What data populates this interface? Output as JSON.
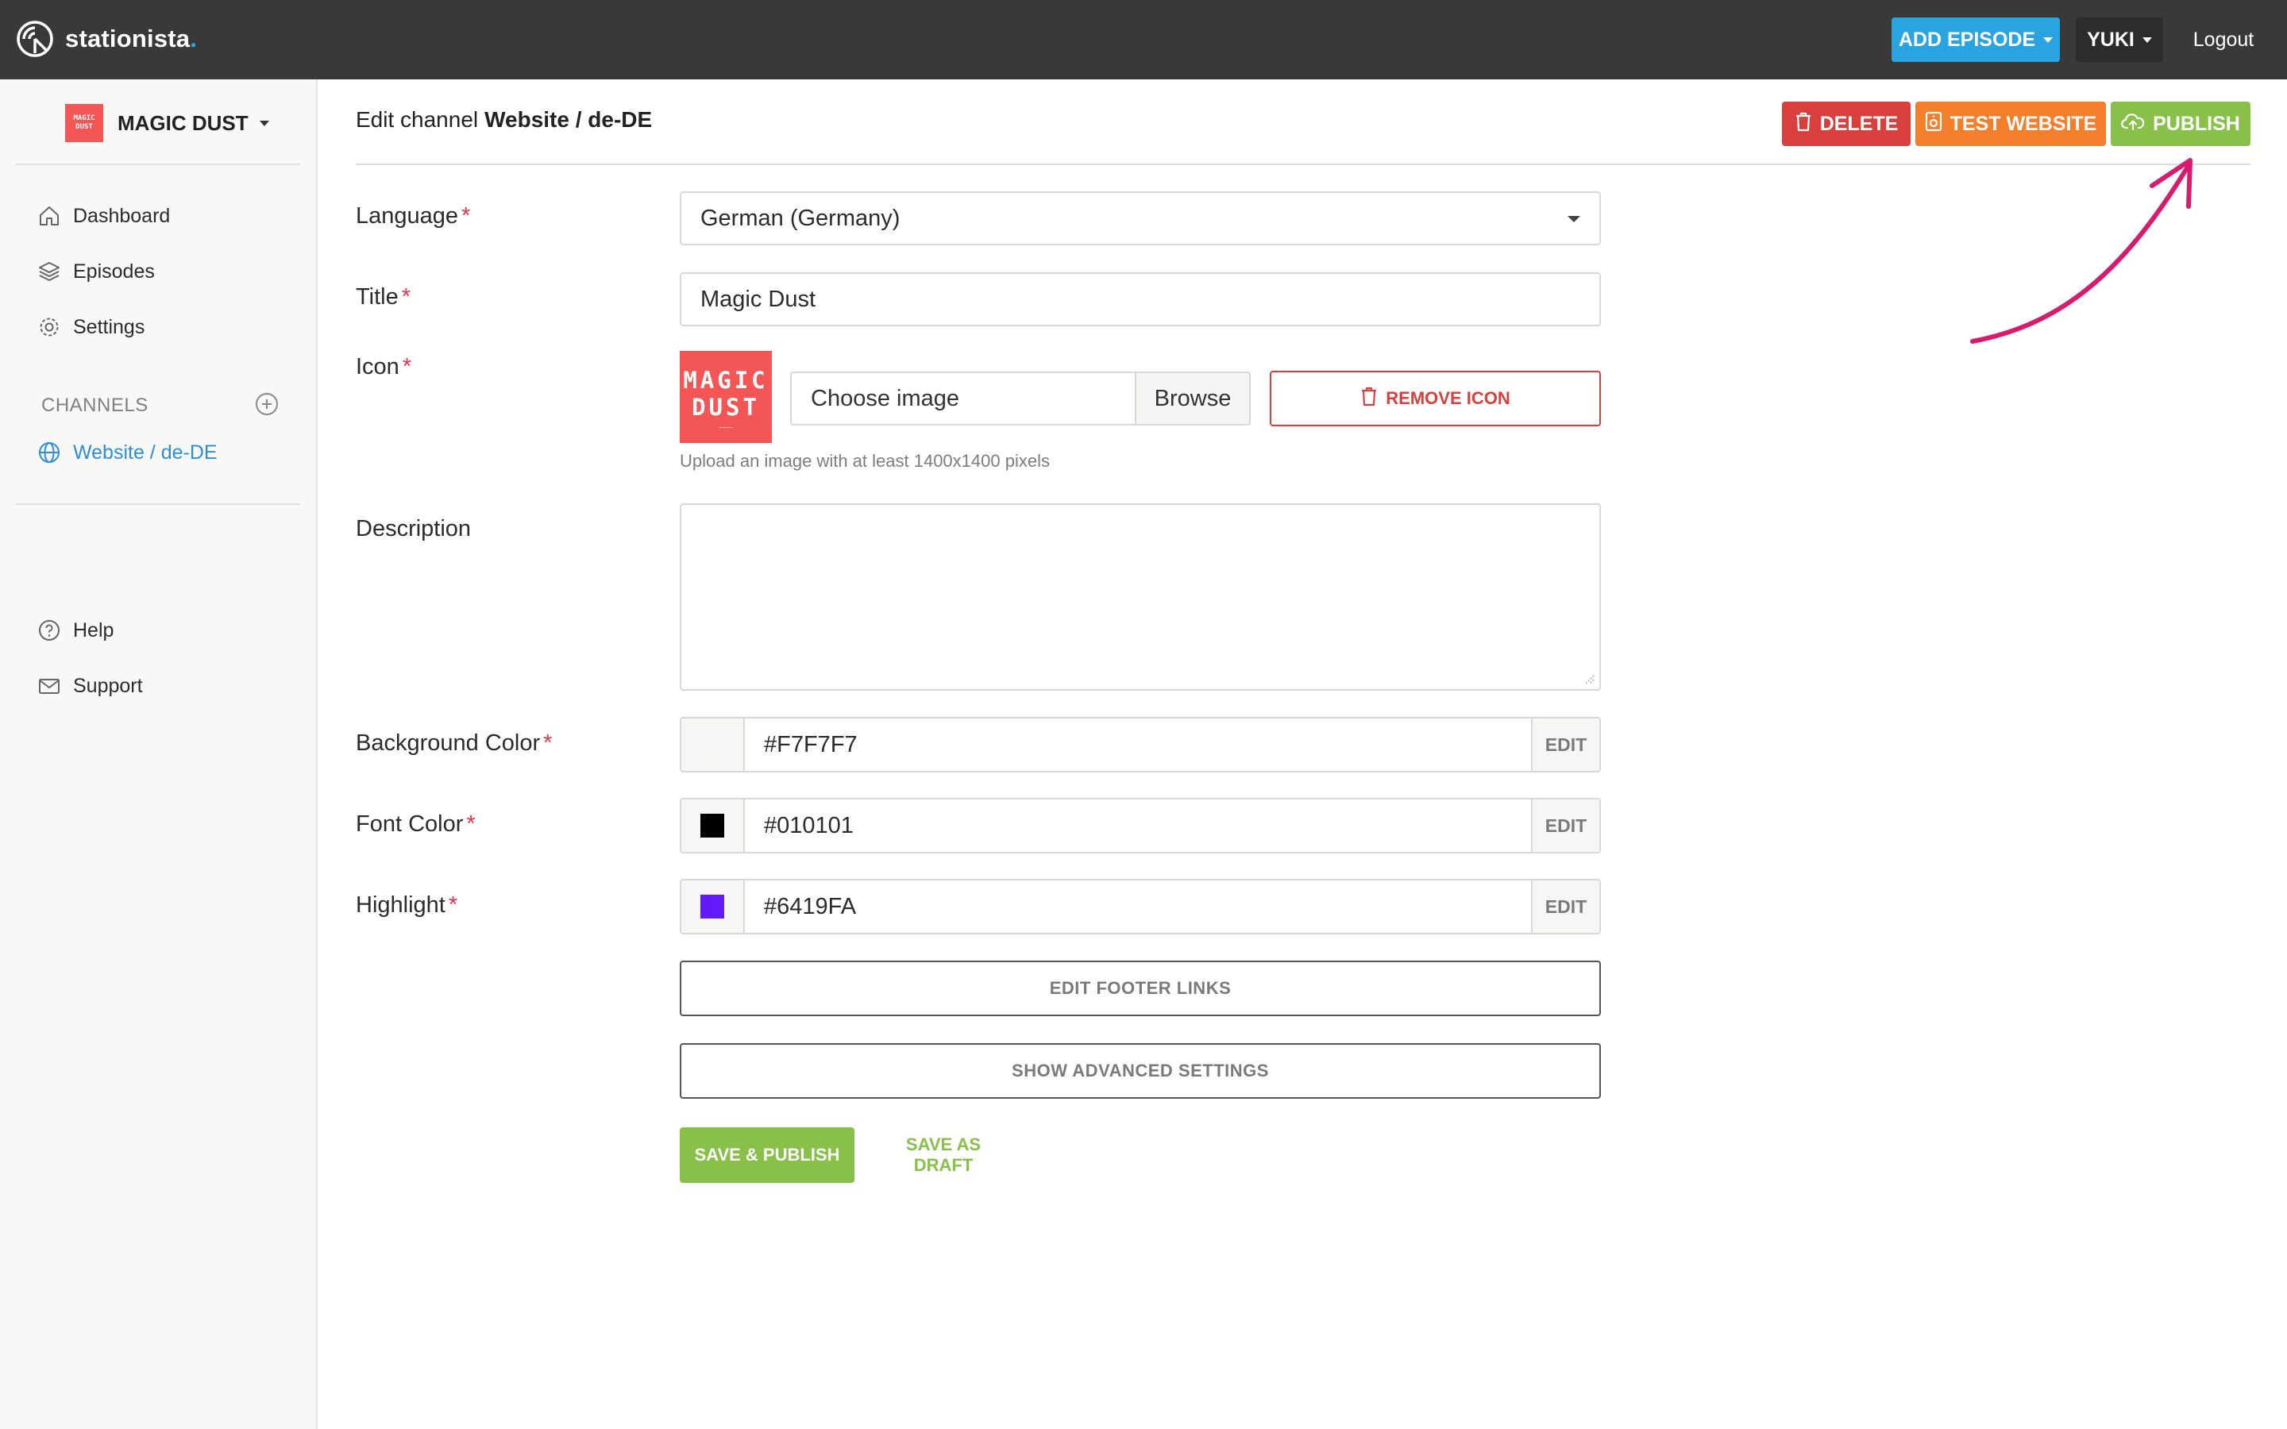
{
  "brand": {
    "name": "stationista",
    "dot": "."
  },
  "topbar": {
    "add_episode_label": "ADD EPISODE",
    "user_label": "YUKI",
    "logout_label": "Logout"
  },
  "sidebar": {
    "shop_logo_line1": "MAGIC",
    "shop_logo_line2": "DUST",
    "shop_name": "MAGIC DUST",
    "nav": [
      {
        "label": "Dashboard",
        "icon": "home-icon"
      },
      {
        "label": "Episodes",
        "icon": "layers-icon"
      },
      {
        "label": "Settings",
        "icon": "gear-icon"
      }
    ],
    "channels_title": "CHANNELS",
    "channels": [
      {
        "label": "Website / de-DE",
        "icon": "globe-icon",
        "active": true
      }
    ],
    "footer_nav": [
      {
        "label": "Help",
        "icon": "question-circle-icon"
      },
      {
        "label": "Support",
        "icon": "envelope-icon"
      }
    ]
  },
  "header": {
    "title_prefix": "Edit channel",
    "title_strong": "Website / de-DE",
    "delete_label": "DELETE",
    "test_label": "TEST WEBSITE",
    "publish_label": "PUBLISH"
  },
  "form": {
    "language": {
      "label": "Language",
      "value": "German (Germany)"
    },
    "title": {
      "label": "Title",
      "value": "Magic Dust"
    },
    "icon": {
      "label": "Icon",
      "preview_line1": "MAGIC",
      "preview_line2": "DUST",
      "file_placeholder": "Choose image",
      "browse_label": "Browse",
      "remove_label": "REMOVE ICON",
      "help": "Upload an image with at least 1400x1400 pixels"
    },
    "description": {
      "label": "Description",
      "value": ""
    },
    "background_color": {
      "label": "Background Color",
      "value": "#F7F7F7",
      "swatch": "#F7F7F7",
      "edit_label": "EDIT"
    },
    "font_color": {
      "label": "Font Color",
      "value": "#010101",
      "swatch": "#010101",
      "edit_label": "EDIT"
    },
    "highlight": {
      "label": "Highlight",
      "value": "#6419FA",
      "swatch": "#6419FA",
      "edit_label": "EDIT"
    },
    "required_mark": "*",
    "footer_links_label": "EDIT FOOTER LINKS",
    "advanced_label": "SHOW ADVANCED SETTINGS",
    "save_publish_label": "SAVE & PUBLISH",
    "save_draft_label": "SAVE AS DRAFT"
  },
  "colors": {
    "accent_blue": "#2aa4e1",
    "danger": "#d93f3c",
    "warning": "#f37e2c",
    "success": "#88c04a",
    "annotation": "#d81b6f"
  }
}
